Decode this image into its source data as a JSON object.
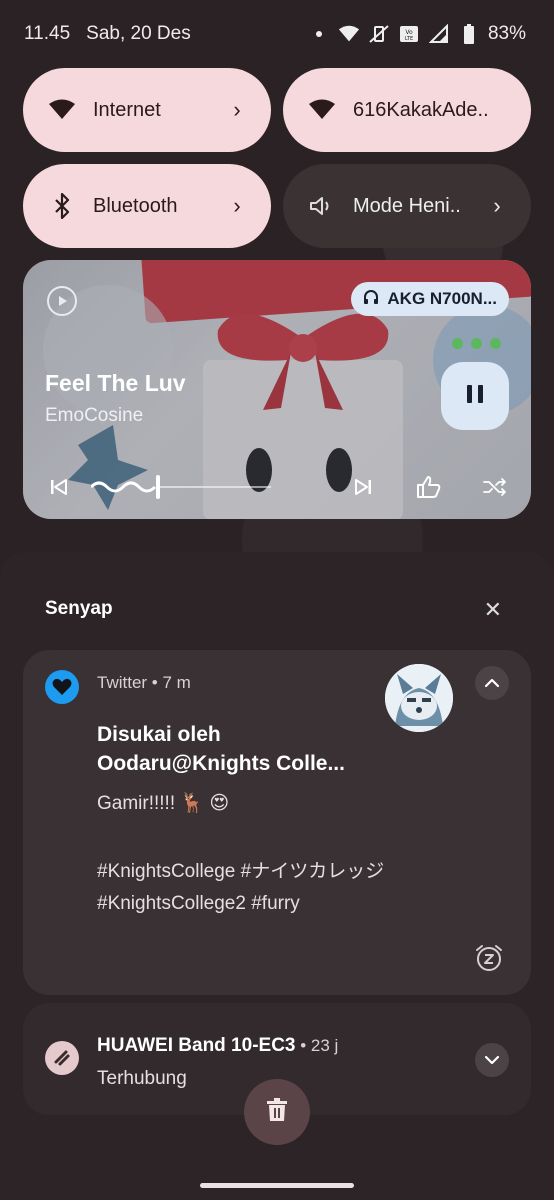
{
  "status_bar": {
    "time": "11.45",
    "date": "Sab, 20 Des",
    "battery": "83%",
    "icons": [
      "dot-icon",
      "wifi-icon",
      "vibrate-off-icon",
      "volte-icon",
      "signal-icon",
      "battery-icon"
    ]
  },
  "quick_tiles": [
    {
      "label": "Internet",
      "icon": "wifi-icon",
      "state": "on",
      "chevron": "›"
    },
    {
      "label": "616KakakAde..",
      "icon": "wifi-icon",
      "state": "on",
      "chevron": ""
    },
    {
      "label": "Bluetooth",
      "icon": "bluetooth-icon",
      "state": "on",
      "chevron": "›"
    },
    {
      "label": "Mode Heni..",
      "icon": "volume-icon",
      "state": "off",
      "chevron": "›"
    }
  ],
  "media": {
    "title": "Feel The Luv",
    "artist": "EmoCosine",
    "output_device": "AKG N700N...",
    "progress": 0.35,
    "colors": {
      "chip": "#dde8f6",
      "accent_red": "#d4404a"
    }
  },
  "notifications": {
    "section_title": "Senyap",
    "close_label": "✕",
    "twitter": {
      "app": "Twitter",
      "sep": "•",
      "time": "7 m",
      "title_line1": "Disukai oleh",
      "title_line2": "Oodaru@Knights Colle...",
      "body_line1": "Gamir!!!!! 🦌 😍",
      "body_line2": "#KnightsCollege #ナイツカレッジ",
      "body_line3": "#KnightsCollege2 #furry",
      "icon_color": "#1d9bf0"
    },
    "huawei": {
      "app": "HUAWEI Band 10-EC3",
      "sep": "•",
      "time": "23 j",
      "text": "Terhubung"
    }
  }
}
